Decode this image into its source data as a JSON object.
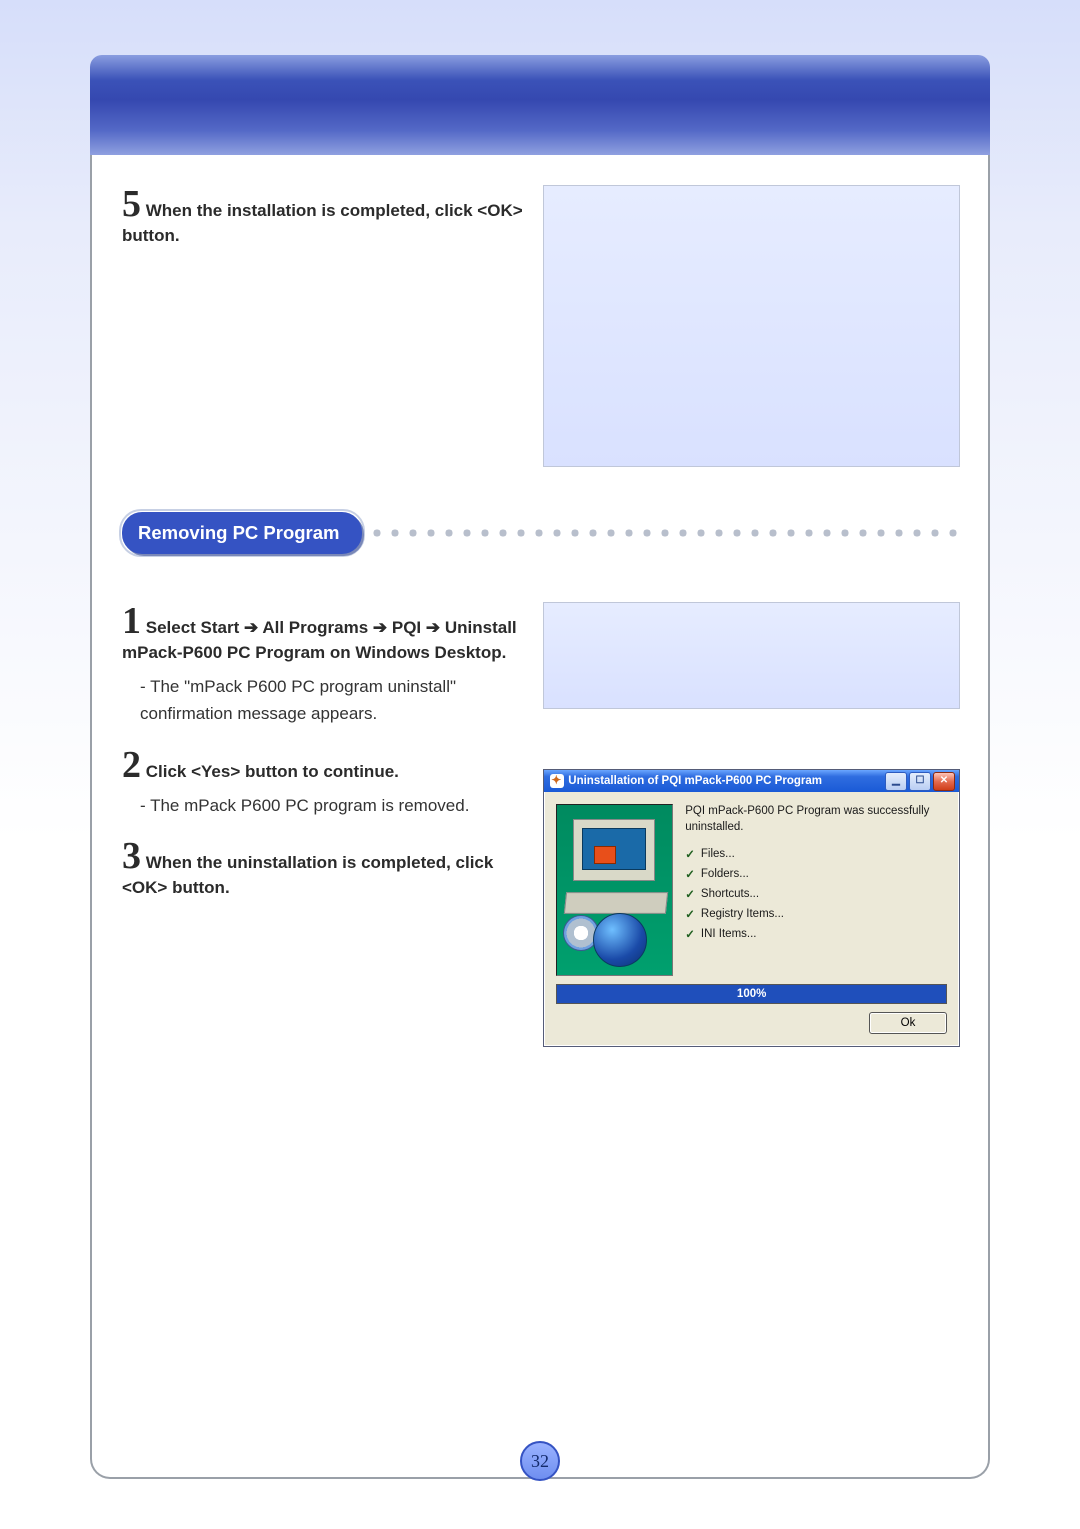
{
  "page_number": "32",
  "step5": {
    "num": "5",
    "head": "When the installation is completed, click <OK> button."
  },
  "section_title": "Removing PC Program",
  "step1": {
    "num": "1",
    "head_parts": {
      "p1": "Select Start ",
      "arrow1": "➔",
      "p2": " All Programs ",
      "arrow2": "➔",
      "p3": " PQI ",
      "arrow3": "➔",
      "p4": " Uninstall mPack-P600 PC Program on Windows Desktop."
    },
    "note": "- The \"mPack P600 PC program uninstall\" confirmation message appears."
  },
  "step2": {
    "num": "2",
    "head": "Click <Yes> button to continue.",
    "note": "- The mPack P600 PC program is removed."
  },
  "step3": {
    "num": "3",
    "head": "When the uninstallation is completed, click <OK> button."
  },
  "dialog": {
    "title": "Uninstallation of PQI mPack-P600 PC Program",
    "min_glyph": "▁",
    "max_glyph": "☐",
    "close_glyph": "✕",
    "message": "PQI mPack-P600 PC Program was successfully uninstalled.",
    "items": [
      "Files...",
      "Folders...",
      "Shortcuts...",
      "Registry Items...",
      "INI Items..."
    ],
    "check": "✓",
    "progress_label": "100%",
    "ok_label": "Ok"
  }
}
